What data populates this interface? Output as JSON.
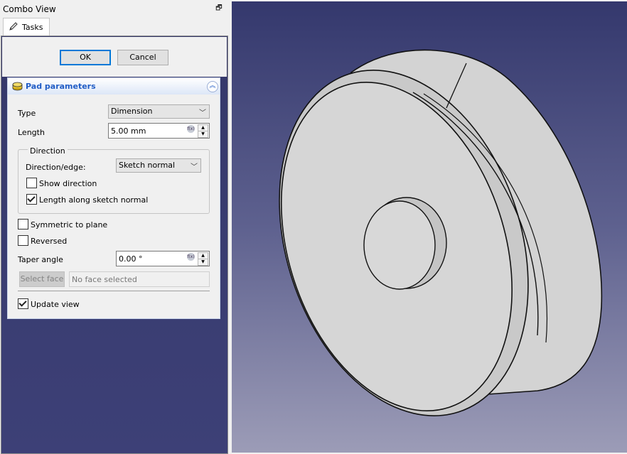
{
  "combo_view": {
    "title": "Combo View",
    "tab": "Tasks"
  },
  "buttons": {
    "ok": "OK",
    "cancel": "Cancel"
  },
  "pad_parameters": {
    "header": "Pad parameters",
    "type": {
      "label": "Type",
      "value": "Dimension"
    },
    "length": {
      "label": "Length",
      "value": "5.00 mm"
    },
    "direction": {
      "group_title": "Direction",
      "edge_label": "Direction/edge:",
      "edge_value": "Sketch normal",
      "show_direction": {
        "label": "Show direction",
        "checked": false
      },
      "length_along_normal": {
        "label": "Length along sketch normal",
        "checked": true
      }
    },
    "symmetric": {
      "label": "Symmetric to plane",
      "checked": false
    },
    "reversed": {
      "label": "Reversed",
      "checked": false
    },
    "taper": {
      "label": "Taper angle",
      "value": "0.00 °"
    },
    "select_face_button": "Select face",
    "face_field_value": "No face selected",
    "update_view": {
      "label": "Update view",
      "checked": true
    }
  },
  "colors": {
    "viewport_top": "#34386d",
    "viewport_bottom": "#9c9cb7",
    "accent_blue": "#215dc6",
    "focus_blue": "#0078d7",
    "model_gray": "#d4d4d4"
  },
  "icons": [
    "float-icon",
    "pencil-icon",
    "pad-icon",
    "collapse-icon",
    "chevron-down-icon",
    "expression-icon"
  ]
}
